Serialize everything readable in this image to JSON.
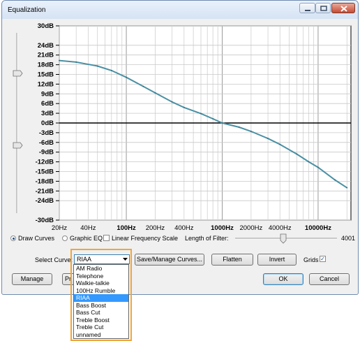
{
  "window": {
    "title": "Equalization"
  },
  "chart_data": {
    "type": "line",
    "x_scale": "log",
    "xlim": [
      20,
      22000
    ],
    "ylim": [
      -30,
      30
    ],
    "y_ticks": [
      "30dB",
      "24dB",
      "21dB",
      "18dB",
      "15dB",
      "12dB",
      "9dB",
      "6dB",
      "3dB",
      "0dB",
      "-3dB",
      "-6dB",
      "-9dB",
      "-12dB",
      "-15dB",
      "-18dB",
      "-21dB",
      "-24dB",
      "-30dB"
    ],
    "y_tick_values": [
      30,
      24,
      21,
      18,
      15,
      12,
      9,
      6,
      3,
      0,
      -3,
      -6,
      -9,
      -12,
      -15,
      -18,
      -21,
      -24,
      -30
    ],
    "x_ticks": [
      "20Hz",
      "40Hz",
      "100Hz",
      "200Hz",
      "400Hz",
      "1000Hz",
      "2000Hz",
      "4000Hz",
      "10000Hz"
    ],
    "x_tick_values": [
      20,
      40,
      100,
      200,
      400,
      1000,
      2000,
      4000,
      10000
    ],
    "x_tick_bold": [
      false,
      false,
      true,
      false,
      false,
      true,
      false,
      false,
      true
    ],
    "grid": true,
    "series": [
      {
        "x": [
          20,
          30,
          50,
          70,
          100,
          150,
          200,
          300,
          400,
          600,
          800,
          1000,
          1500,
          2000,
          3000,
          4000,
          6000,
          8000,
          10000,
          15000,
          20000
        ],
        "y": [
          19.3,
          18.8,
          17.6,
          16.2,
          14.1,
          11.3,
          9.3,
          6.5,
          4.8,
          2.9,
          1.3,
          0.0,
          -1.3,
          -2.6,
          -4.8,
          -6.6,
          -9.6,
          -12.0,
          -13.7,
          -17.6,
          -20.0
        ]
      }
    ],
    "color": "#4a90a4"
  },
  "controls": {
    "draw_curves": "Draw Curves",
    "graphic_eq": "Graphic EQ",
    "linear_freq": "Linear Frequency Scale",
    "filter_length_label": "Length of Filter:",
    "filter_length_value": "4001",
    "select_curve_label": "Select Curve:",
    "select_curve_value": "RIAA",
    "save_manage": "Save/Manage Curves...",
    "flatten": "Flatten",
    "invert": "Invert",
    "grids": "Grids",
    "manage": "Manage",
    "preview_partial": "Pr",
    "ok": "OK",
    "cancel": "Cancel"
  },
  "dropdown": {
    "items": [
      "AM Radio",
      "Telephone",
      "Walkie-talkie",
      "100Hz Rumble",
      "RIAA",
      "Bass Boost",
      "Bass Cut",
      "Treble Boost",
      "Treble Cut",
      "unnamed"
    ],
    "selected": 4
  },
  "colors": {
    "highlight": "#f0a63a",
    "selection": "#3399ff",
    "curve": "#4a90a4"
  }
}
